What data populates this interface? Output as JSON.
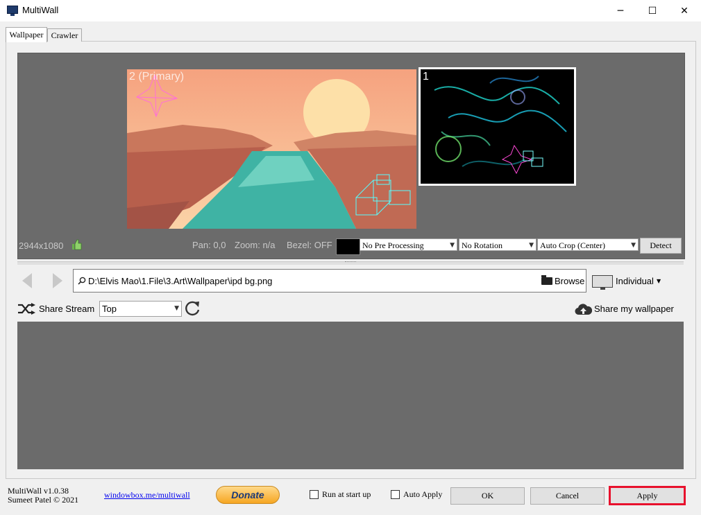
{
  "window": {
    "title": "MultiWall"
  },
  "tabs": [
    {
      "label": "Wallpaper"
    },
    {
      "label": "Crawler"
    }
  ],
  "preview": {
    "monitors": [
      {
        "label": "2 (Primary)"
      },
      {
        "label": "1"
      }
    ],
    "resolution": "2944x1080",
    "pan": "Pan: 0,0",
    "zoom": "Zoom: n/a",
    "bezel": "Bezel: OFF",
    "pre_processing": "No Pre Processing",
    "rotation": "No Rotation",
    "crop": "Auto Crop (Center)",
    "detect_label": "Detect"
  },
  "path": {
    "value": "D:\\Elvis Mao\\1.File\\3.Art\\Wallpaper\\ipd bg.png",
    "browse_label": "Browse",
    "mode": "Individual"
  },
  "share": {
    "stream_label": "Share Stream",
    "sort_value": "Top",
    "wallpaper_label": "Share my wallpaper"
  },
  "footer": {
    "version": "MultiWall v1.0.38",
    "author": "Sumeet Patel © 2021",
    "link": "windowbox.me/multiwall",
    "donate": "Donate",
    "run_at_startup": "Run at start up",
    "auto_apply": "Auto Apply",
    "ok": "OK",
    "cancel": "Cancel",
    "apply": "Apply"
  },
  "colors": {
    "preview_bg": "#6b6b6b",
    "highlight": "#e8112d"
  }
}
